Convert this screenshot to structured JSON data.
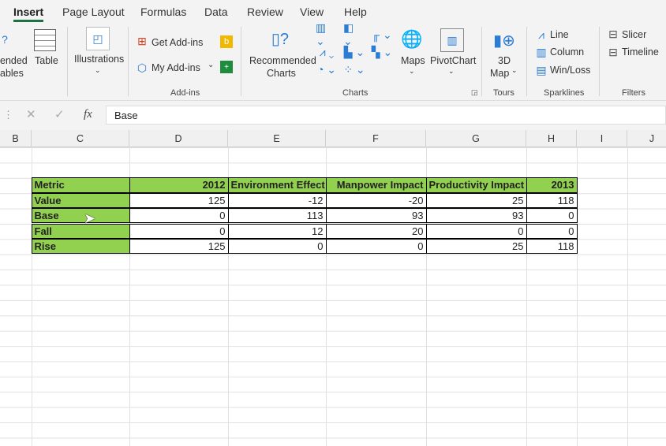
{
  "tabs": [
    "Insert",
    "Page Layout",
    "Formulas",
    "Data",
    "Review",
    "View",
    "Help"
  ],
  "ribbon": {
    "recommended_pivot": [
      "ended",
      "ables"
    ],
    "table": "Table",
    "illustrations": "Illustrations",
    "get_addins": "Get Add-ins",
    "my_addins": "My Add-ins",
    "addins_group": "Add-ins",
    "recommended_charts": [
      "Recommended",
      "Charts"
    ],
    "maps": "Maps",
    "pivotchart": "PivotChart",
    "charts_group": "Charts",
    "map3d": [
      "3D",
      "Map"
    ],
    "tours_group": "Tours",
    "sparklines": [
      "Line",
      "Column",
      "Win/Loss"
    ],
    "sparklines_group": "Sparklines",
    "slicer": "Slicer",
    "timeline": "Timeline",
    "filters_group": "Filters"
  },
  "formula_bar": {
    "fx": "fx",
    "value": "Base"
  },
  "columns": [
    "B",
    "C",
    "D",
    "E",
    "F",
    "G",
    "H",
    "I",
    "J"
  ],
  "table": {
    "header": [
      "Metric",
      "2012",
      "Environment Effect",
      "Manpower Impact",
      "Productivity Impact",
      "2013"
    ],
    "rows": [
      [
        "Value",
        "125",
        "-12",
        "-20",
        "25",
        "118"
      ],
      [
        "Base",
        "0",
        "113",
        "93",
        "93",
        "0"
      ],
      [
        "Fall",
        "0",
        "12",
        "20",
        "0",
        "0"
      ],
      [
        "Rise",
        "125",
        "0",
        "0",
        "25",
        "118"
      ]
    ]
  },
  "colors": {
    "header_fill": "#92d050",
    "accent": "#1e7145"
  }
}
